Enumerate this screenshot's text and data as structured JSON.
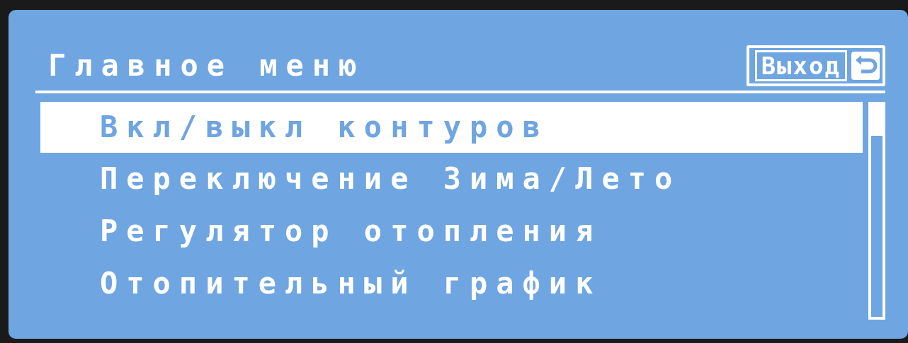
{
  "title": "Главное меню",
  "exit_button": {
    "label": "Выход"
  },
  "menu_items": [
    {
      "label": "Вкл/выкл контуров",
      "selected": true
    },
    {
      "label": "Переключение Зима/Лето",
      "selected": false
    },
    {
      "label": "Регулятор отопления",
      "selected": false
    },
    {
      "label": "Отопительный график",
      "selected": false
    }
  ]
}
